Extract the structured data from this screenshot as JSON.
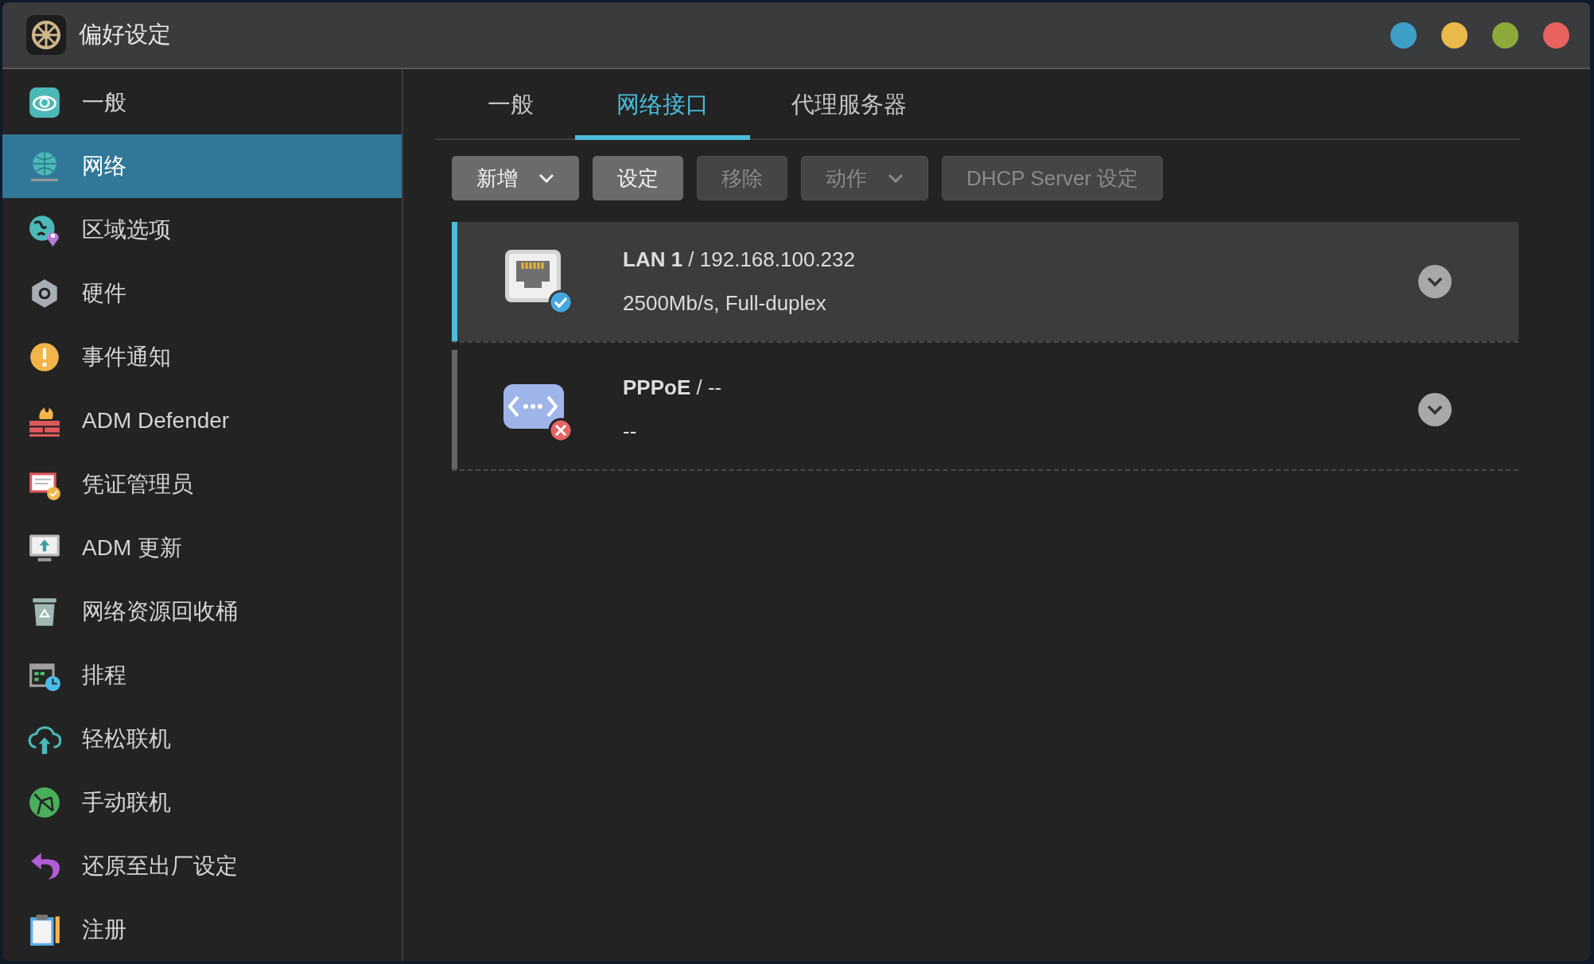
{
  "window": {
    "title": "偏好设定",
    "controls": [
      {
        "color": "#3d9fc6"
      },
      {
        "color": "#e9b949"
      },
      {
        "color": "#8ca93a"
      },
      {
        "color": "#e8625e"
      }
    ]
  },
  "sidebar": {
    "items": [
      {
        "label": "一般",
        "selected": false
      },
      {
        "label": "网络",
        "selected": true
      },
      {
        "label": "区域选项",
        "selected": false
      },
      {
        "label": "硬件",
        "selected": false
      },
      {
        "label": "事件通知",
        "selected": false
      },
      {
        "label": "ADM Defender",
        "selected": false
      },
      {
        "label": "凭证管理员",
        "selected": false
      },
      {
        "label": "ADM 更新",
        "selected": false
      },
      {
        "label": "网络资源回收桶",
        "selected": false
      },
      {
        "label": "排程",
        "selected": false
      },
      {
        "label": "轻松联机",
        "selected": false
      },
      {
        "label": "手动联机",
        "selected": false
      },
      {
        "label": "还原至出厂设定",
        "selected": false
      },
      {
        "label": "注册",
        "selected": false
      }
    ]
  },
  "tabs": [
    {
      "label": "一般",
      "selected": false
    },
    {
      "label": "网络接口",
      "selected": true
    },
    {
      "label": "代理服务器",
      "selected": false
    }
  ],
  "toolbar": [
    {
      "label": "新增",
      "disabled": false,
      "dropdown": true
    },
    {
      "label": "设定",
      "disabled": false,
      "dropdown": false
    },
    {
      "label": "移除",
      "disabled": true,
      "dropdown": false
    },
    {
      "label": "动作",
      "disabled": true,
      "dropdown": true
    },
    {
      "label": "DHCP Server 设定",
      "disabled": true,
      "dropdown": false
    }
  ],
  "interfaces": [
    {
      "kind": "ethernet",
      "title": "**LAN 1** / 192.168.100.232",
      "detail": "2500Mb/s, Full-duplex",
      "connected": true,
      "selected": true
    },
    {
      "kind": "pppoe",
      "title": "**PPPoE** / --",
      "detail": "--",
      "connected": false,
      "selected": false
    }
  ]
}
